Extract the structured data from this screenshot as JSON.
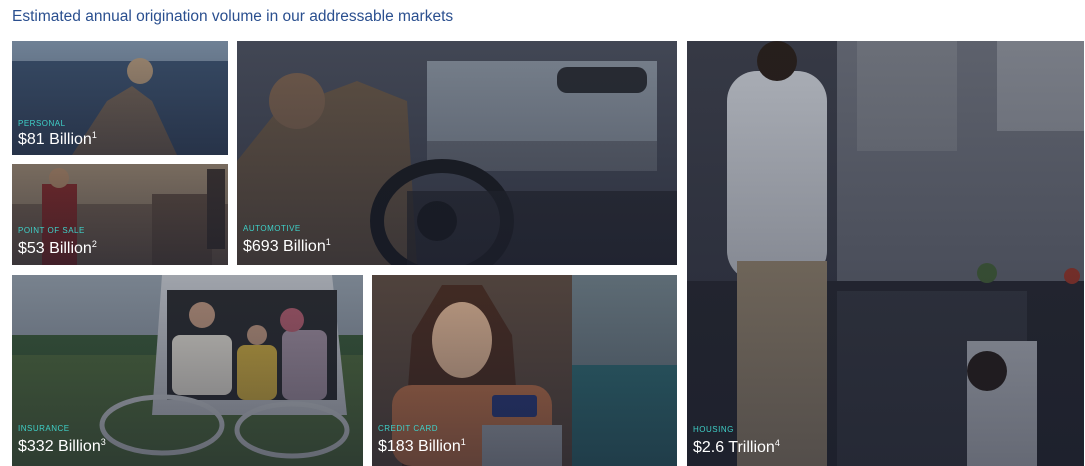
{
  "heading": "Estimated annual origination volume in our addressable markets",
  "tiles": {
    "personal": {
      "category": "PERSONAL",
      "amount": "$81 Billion",
      "note": "1"
    },
    "pos": {
      "category": "POINT OF SALE",
      "amount": "$53 Billion",
      "note": "2"
    },
    "automotive": {
      "category": "AUTOMOTIVE",
      "amount": "$693 Billion",
      "note": "1"
    },
    "insurance": {
      "category": "INSURANCE",
      "amount": "$332 Billion",
      "note": "3"
    },
    "credit": {
      "category": "CREDIT CARD",
      "amount": "$183 Billion",
      "note": "1"
    },
    "housing": {
      "category": "HOUSING",
      "amount": "$2.6 Trillion",
      "note": "4"
    }
  },
  "colors": {
    "heading": "#2a4f8f",
    "category": "#3fd0c8",
    "amount": "#ffffff"
  }
}
